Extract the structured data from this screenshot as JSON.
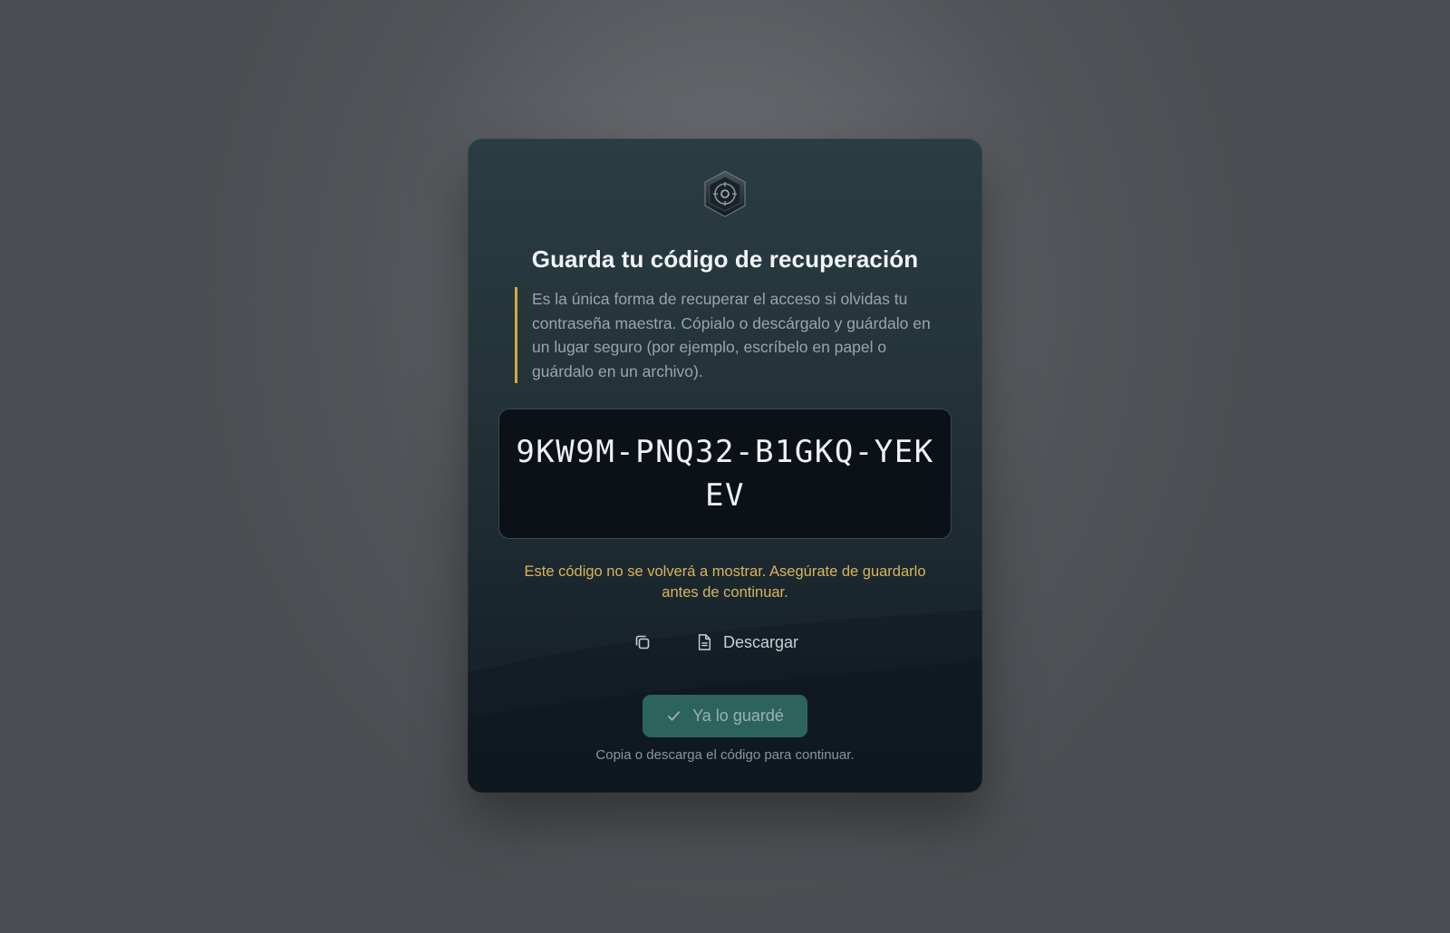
{
  "dialog": {
    "title": "Guarda tu código de recuperación",
    "notice": "Es la única forma de recuperar el acceso si olvidas tu contraseña maestra. Cópialo o descárgalo y guárdalo en un lugar seguro (por ejemplo, escríbelo en papel o guárdalo en un archivo).",
    "recovery_code": "9KW9M-PNQ32-B1GKQ-YEKEV",
    "warning": "Este código no se volverá a mostrar. Asegúrate de guardarlo antes de continuar.",
    "actions": {
      "copy_icon": "copy-icon",
      "download_icon": "document-icon",
      "download_label": "Descargar"
    },
    "confirm_button": {
      "icon": "check-icon",
      "label": "Ya lo guardé",
      "disabled": true
    },
    "hint": "Copia o descarga el código para continuar."
  },
  "colors": {
    "accent_warning": "#d9b35d",
    "notice_border": "#d4a845",
    "confirm_button": "#2f6b63",
    "card_top": "#2a3d43",
    "card_bottom": "#141d25"
  }
}
